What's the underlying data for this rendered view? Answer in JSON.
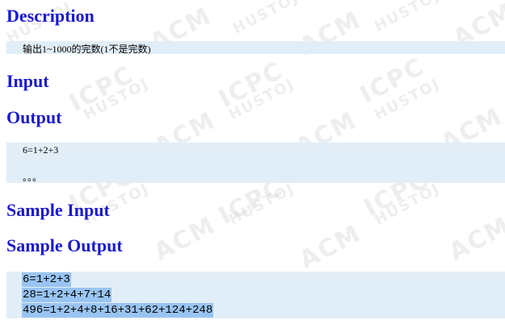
{
  "watermark": {
    "text_hustoj": "HUSTOJ",
    "text_acm": "ACM",
    "text_icpc": "ICPC"
  },
  "sections": {
    "description_heading": "Description",
    "description_text": "输出1~1000的完数(1不是完数)",
    "input_heading": "Input",
    "output_heading": "Output",
    "output_line1": "6=1+2+3",
    "output_line2": "。。。",
    "sample_input_heading": "Sample Input",
    "sample_output_heading": "Sample Output"
  },
  "sample_output": {
    "lines": [
      "6=1+2+3",
      "28=1+2+4+7+14",
      "496=1+2+4+8+16+31+62+124+248"
    ]
  },
  "colors": {
    "heading": "#1a1acc",
    "box_background": "#e2eef7",
    "selection_highlight": "#99c4f2"
  }
}
